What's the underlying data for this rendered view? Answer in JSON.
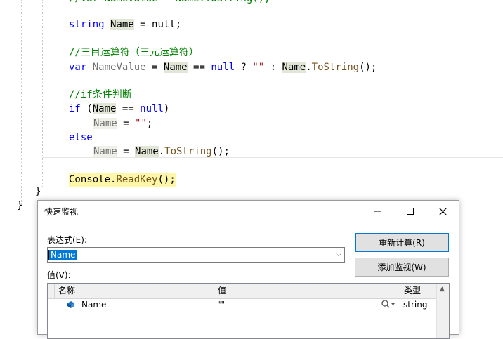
{
  "editor": {
    "cut_line": "//var NameValue = Name.ToString();",
    "line_decl": {
      "type": "string",
      "var": "Name",
      "rest": " = null;"
    },
    "comment_ternary": "//三目运算符（三元运算符）",
    "line_ternary": {
      "kw": "var",
      "var": "NameValue",
      "eq": " = ",
      "name1": "Name",
      "op": " == ",
      "null": "null",
      "q": " ? ",
      "str": "\"\"",
      "colon": " : ",
      "name2": "Name",
      "dot": ".",
      "method": "ToString",
      "tail": "();"
    },
    "comment_if": "//if条件判断",
    "line_if": {
      "kw": "if",
      "open": " (",
      "name": "Name",
      "op": " == ",
      "null": "null",
      "close": ")"
    },
    "line_assign_empty": {
      "name": "Name",
      "eq": " = ",
      "str": "\"\"",
      "tail": ";"
    },
    "line_else": "else",
    "line_assign_tostring": {
      "name": "Name",
      "eq": " = ",
      "name2": "Name",
      "dot": ".",
      "method": "ToString",
      "tail": "();"
    },
    "line_readkey": {
      "cls": "Console",
      "dot": ".",
      "method": "ReadKey",
      "tail": "();"
    },
    "brace1": "}",
    "brace2": "}"
  },
  "dialog": {
    "title": "快速监视",
    "expression_label": "表达式(E):",
    "expression_value": "Name",
    "value_label": "值(V):",
    "recalc_button": "重新计算(R)",
    "add_watch_button": "添加监视(W)",
    "columns": {
      "name": "名称",
      "value": "值",
      "type": "类型"
    },
    "rows": [
      {
        "name": "Name",
        "value": "\"\"",
        "type": "string"
      }
    ]
  },
  "colors": {
    "accent": "#0078d7",
    "keyword": "#0000ff",
    "comment": "#008000",
    "method": "#74531f"
  }
}
